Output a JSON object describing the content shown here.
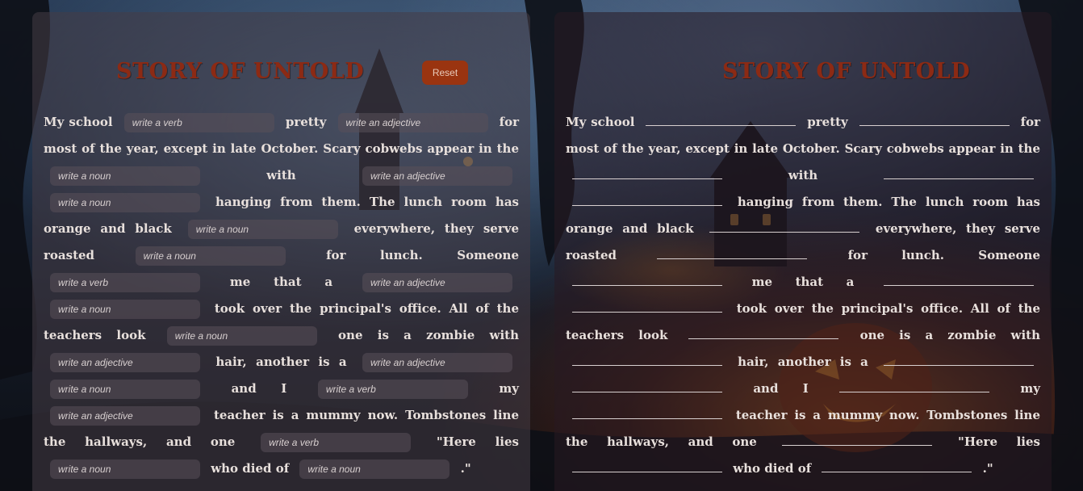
{
  "title": "STORY OF UNTOLD",
  "reset_label": "Reset",
  "segments": [
    {
      "t": "My school"
    },
    {
      "b": "write a verb"
    },
    {
      "t": "pretty"
    },
    {
      "b": "write an adjective"
    },
    {
      "t": "for most of the year, except in late October. Scary cobwebs appear in the"
    },
    {
      "b": "write a noun"
    },
    {
      "t": "with"
    },
    {
      "b": "write an adjective"
    },
    {
      "b": "write a noun"
    },
    {
      "t": "hanging from them. The lunch room has orange and black"
    },
    {
      "b": "write a noun"
    },
    {
      "t": "everywhere, they serve roasted"
    },
    {
      "b": "write a noun"
    },
    {
      "t": "for lunch. Someone"
    },
    {
      "b": "write a verb"
    },
    {
      "t": "me that a"
    },
    {
      "b": "write an adjective"
    },
    {
      "b": "write a noun"
    },
    {
      "t": "took over the principal's office. All of the teachers look"
    },
    {
      "b": "write a noun"
    },
    {
      "t": "one is a zombie with"
    },
    {
      "b": "write an adjective"
    },
    {
      "t": "hair, another is a"
    },
    {
      "b": "write an adjective"
    },
    {
      "b": "write a noun"
    },
    {
      "t": "and I"
    },
    {
      "b": "write a verb"
    },
    {
      "t": "my"
    },
    {
      "b": "write an adjective"
    },
    {
      "t": "teacher is a mummy now. Tombstones line the hallways, and one"
    },
    {
      "b": "write a verb"
    },
    {
      "t": "\"Here lies"
    },
    {
      "b": "write a noun"
    },
    {
      "t": "who died of"
    },
    {
      "b": "write a noun"
    },
    {
      "t": ".\""
    }
  ]
}
